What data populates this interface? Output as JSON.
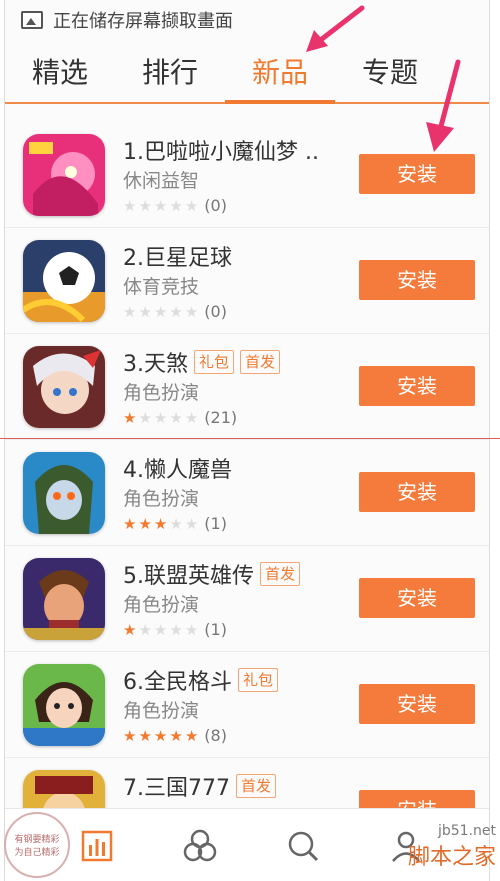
{
  "status_bar": {
    "text": "正在储存屏幕撷取畫面",
    "icon": "image-icon"
  },
  "tabs": [
    {
      "label": "精选",
      "active": false
    },
    {
      "label": "排行",
      "active": false
    },
    {
      "label": "新品",
      "active": true
    },
    {
      "label": "专题",
      "active": false
    }
  ],
  "apps": [
    {
      "title": "1.巴啦啦小魔仙梦 ..",
      "category": "休闲益智",
      "stars": 0,
      "count": "(0)",
      "badges": [],
      "install": "安装"
    },
    {
      "title": "2.巨星足球",
      "category": "体育竞技",
      "stars": 0,
      "count": "(0)",
      "badges": [],
      "install": "安装"
    },
    {
      "title": "3.天煞",
      "category": "角色扮演",
      "stars": 1,
      "count": "(21)",
      "badges": [
        "礼包",
        "首发"
      ],
      "install": "安装"
    },
    {
      "title": "4.懒人魔兽",
      "category": "角色扮演",
      "stars": 3,
      "count": "(1)",
      "badges": [],
      "install": "安装"
    },
    {
      "title": "5.联盟英雄传",
      "category": "角色扮演",
      "stars": 1,
      "count": "(1)",
      "badges": [
        "首发"
      ],
      "install": "安装"
    },
    {
      "title": "6.全民格斗",
      "category": "角色扮演",
      "stars": 5,
      "count": "(8)",
      "badges": [
        "礼包"
      ],
      "install": "安装"
    },
    {
      "title": "7.三国777",
      "category": "",
      "stars": 0,
      "count": "",
      "badges": [
        "首发"
      ],
      "install": "安装"
    }
  ],
  "bottom_nav": [
    "chart-icon",
    "circles-icon",
    "search-icon",
    "user-icon"
  ],
  "stamp": {
    "line1": "有钢要精彩",
    "line2": "为自己精彩"
  },
  "watermark": {
    "site": "jb51.net",
    "name": "脚本之家"
  },
  "colors": {
    "accent": "#f47b3b",
    "annotation_arrow": "#e8336d"
  }
}
